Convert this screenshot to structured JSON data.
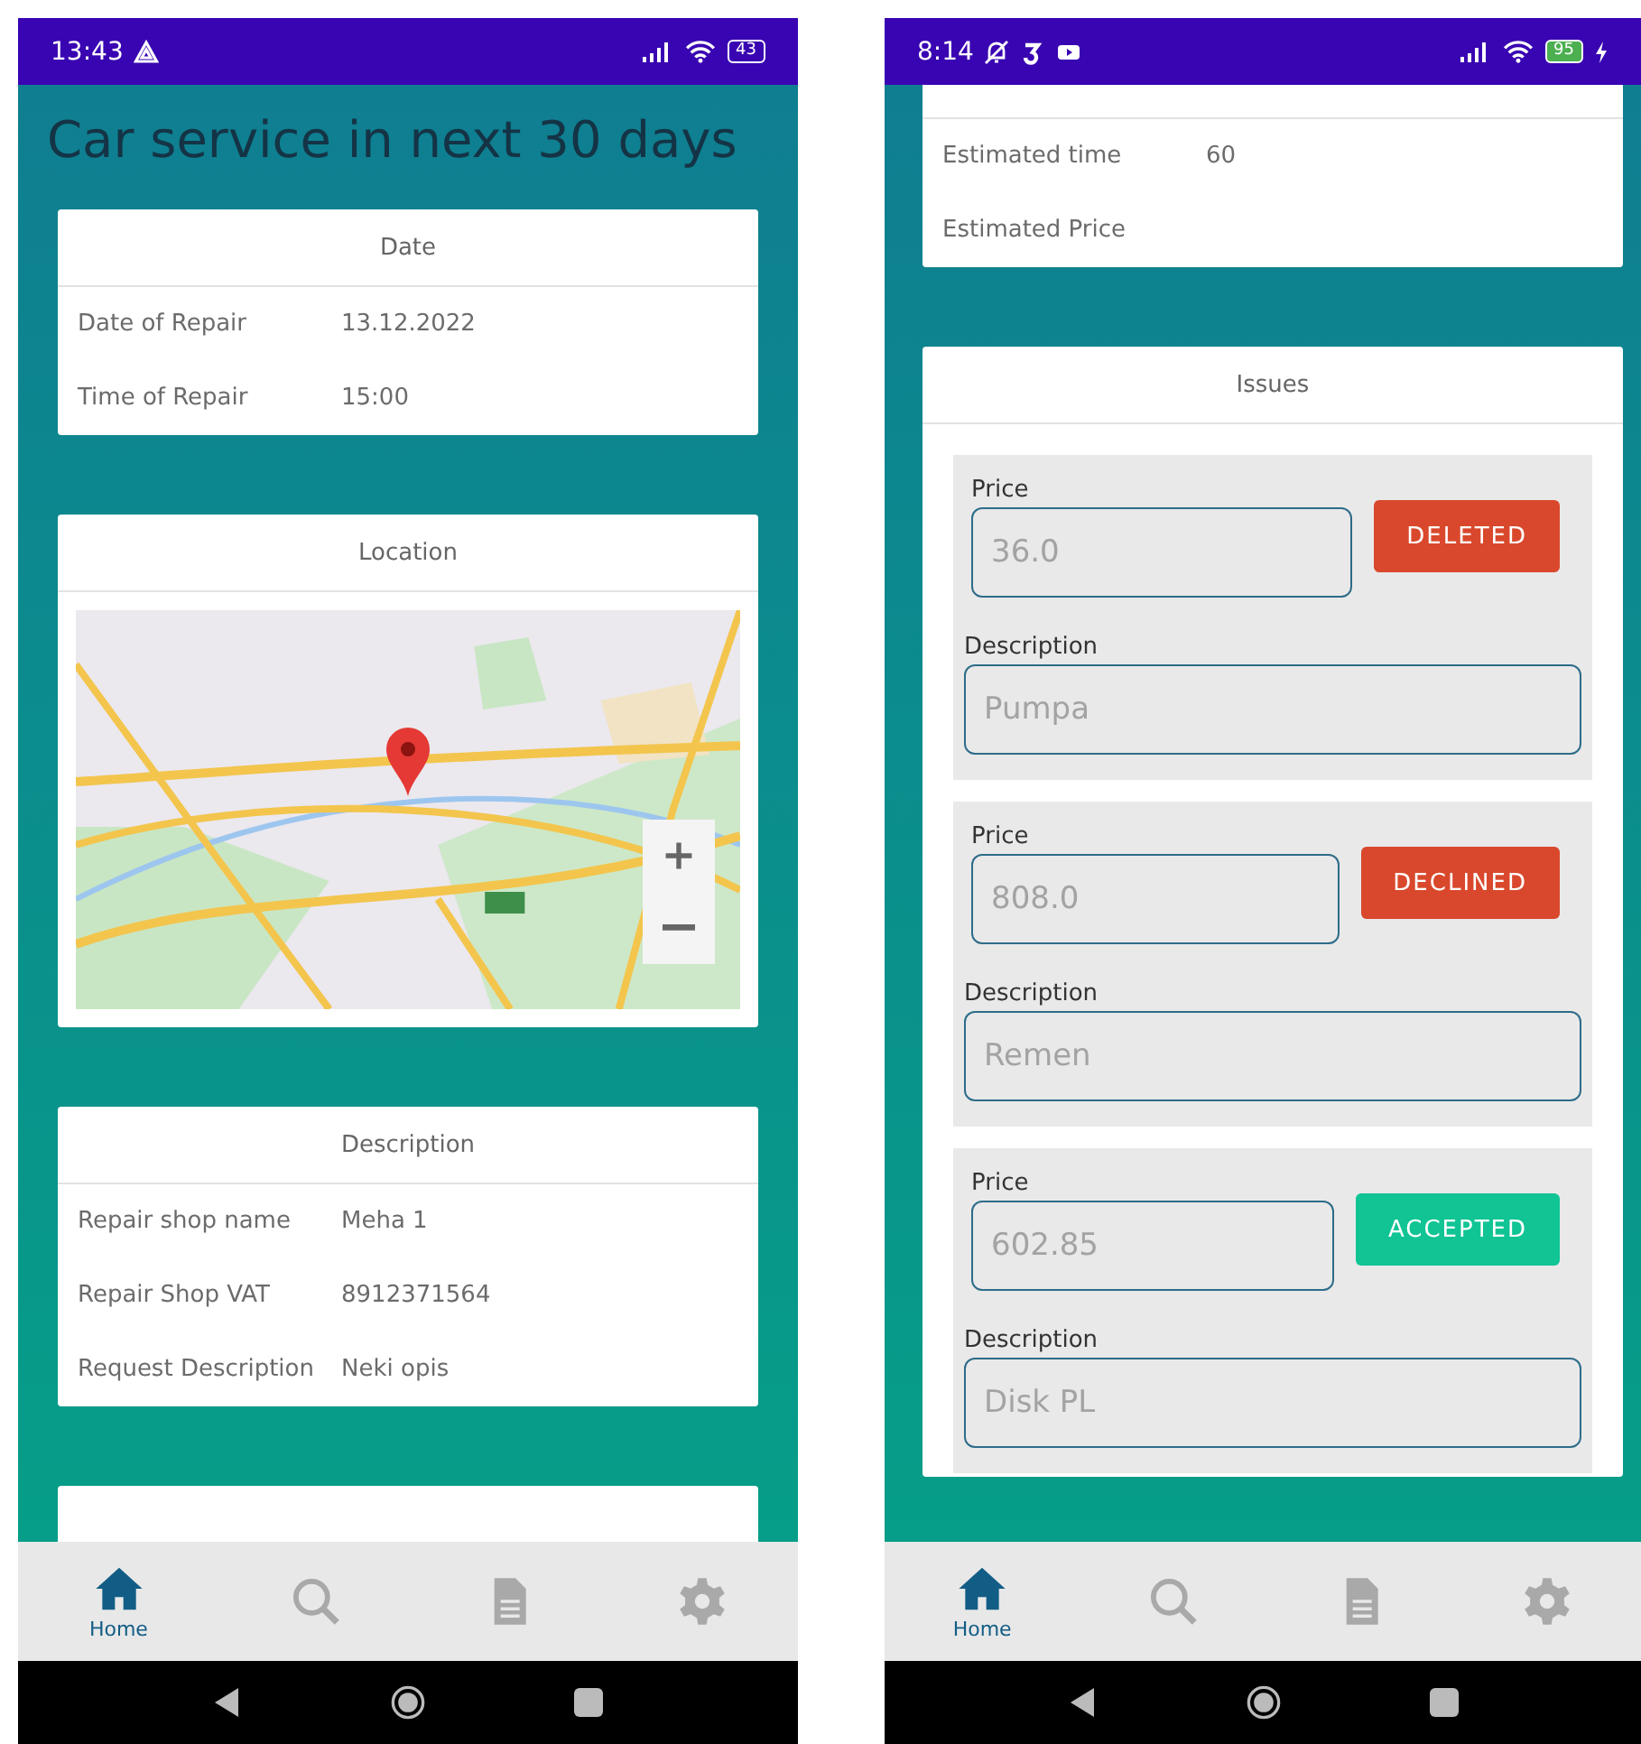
{
  "phones": [
    {
      "status_bar": {
        "time": "13:43",
        "notification_icons": [
          {
            "kind": "drive"
          }
        ],
        "battery": "43",
        "charging": false
      },
      "title": "Car service in next 30 days",
      "cards": [
        {
          "kind": "table",
          "header": "Date",
          "rows": [
            {
              "label": "Date of Repair",
              "value": "13.12.2022"
            },
            {
              "label": "Time of Repair",
              "value": "15:00"
            }
          ]
        },
        {
          "kind": "map",
          "header": "Location"
        },
        {
          "kind": "table",
          "header": "Description",
          "rows": [
            {
              "label": "Repair shop name",
              "value": "Meha 1"
            },
            {
              "label": "Repair Shop VAT",
              "value": "8912371564"
            },
            {
              "label": "Request Description",
              "value": "Neki opis"
            }
          ]
        },
        {
          "kind": "empty"
        }
      ],
      "nav": [
        {
          "kind": "home",
          "label": "Home",
          "selected": true
        },
        {
          "kind": "search",
          "selected": false
        },
        {
          "kind": "document",
          "selected": false
        },
        {
          "kind": "gear",
          "selected": false
        }
      ]
    },
    {
      "status_bar": {
        "time": "8:14",
        "notification_icons": [
          {
            "kind": "mute"
          },
          {
            "kind": "app"
          },
          {
            "kind": "video"
          }
        ],
        "battery": "95",
        "charging": true
      },
      "cards": [
        {
          "kind": "table",
          "clipped": true,
          "rows": [
            {
              "label": "Estimated time",
              "value": "60"
            },
            {
              "label": "Estimated Price"
            }
          ]
        },
        {
          "kind": "issues",
          "header": "Issues",
          "issues": [
            {
              "price_label": "Price",
              "price": "36.0",
              "status": "DELETED",
              "color": "#d9482c",
              "description_label": "Description",
              "description": "Pumpa"
            },
            {
              "price_label": "Price",
              "price": "808.0",
              "status": "DECLINED",
              "color": "#d9482c",
              "description_label": "Description",
              "description": "Remen"
            },
            {
              "price_label": "Price",
              "price": "602.85",
              "status": "ACCEPTED",
              "color": "#10c494",
              "description_label": "Description",
              "description": "Disk PL"
            }
          ]
        }
      ],
      "nav": [
        {
          "kind": "home",
          "label": "Home",
          "selected": true
        },
        {
          "kind": "search",
          "selected": false
        },
        {
          "kind": "document",
          "selected": false
        },
        {
          "kind": "gear",
          "selected": false
        }
      ]
    }
  ]
}
